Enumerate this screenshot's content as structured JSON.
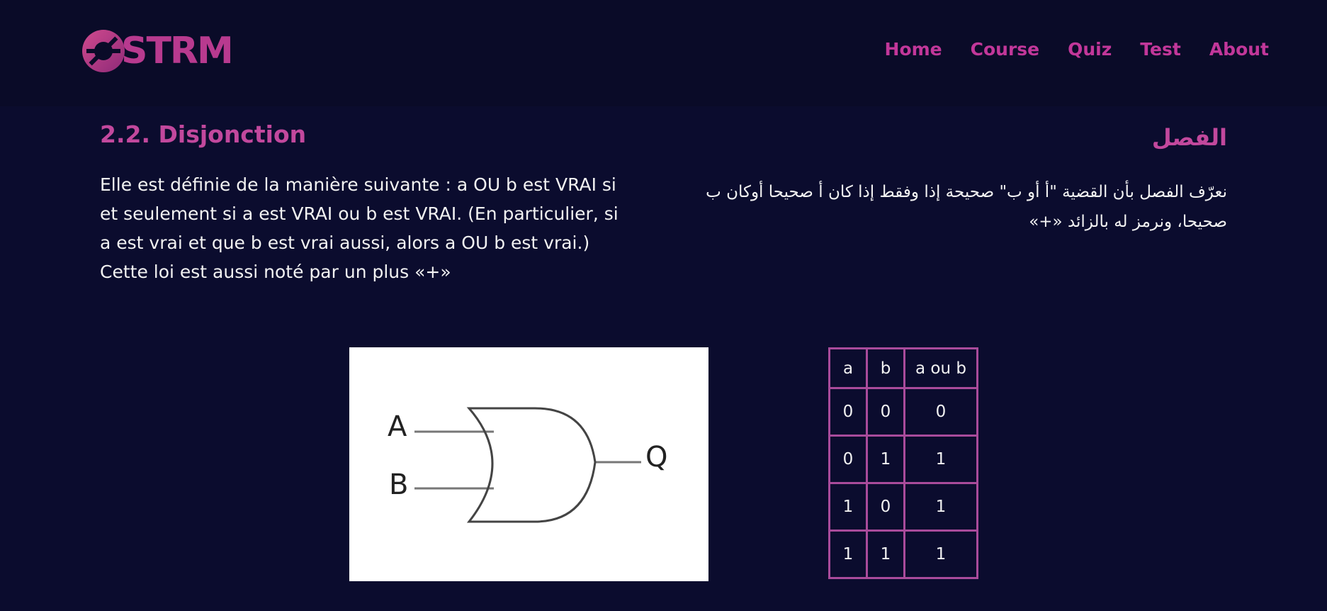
{
  "header": {
    "logo_text": "STRM",
    "nav": [
      "Home",
      "Course",
      "Quiz",
      "Test",
      "About"
    ]
  },
  "content": {
    "fr": {
      "title": "2.2. Disjonction",
      "body": "Elle est définie de la manière suivante : a OU b est VRAI si et seulement si a est VRAI ou b est VRAI. (En particulier, si a est vrai et que b est vrai aussi, alors a OU b est vrai.) Cette loi est aussi noté par un plus «+»"
    },
    "ar": {
      "title": "الفصل",
      "body": "نعرّف الفصل بأن القضية \"أ أو ب\" صحيحة إذا وفقط إذا كان أ صحيحا أوكان ب صحيحا، ونرمز له بالزائد «+»"
    },
    "gate": {
      "input_a": "A",
      "input_b": "B",
      "output": "Q"
    },
    "truth_table": {
      "headers": [
        "a",
        "b",
        "a ou b"
      ],
      "rows": [
        [
          "0",
          "0",
          "0"
        ],
        [
          "0",
          "1",
          "1"
        ],
        [
          "1",
          "0",
          "1"
        ],
        [
          "1",
          "1",
          "1"
        ]
      ]
    }
  },
  "colors": {
    "background": "#0b0c2e",
    "header_bg": "#0a0b28",
    "accent": "#c2379a",
    "table_border": "#a94b9b"
  }
}
